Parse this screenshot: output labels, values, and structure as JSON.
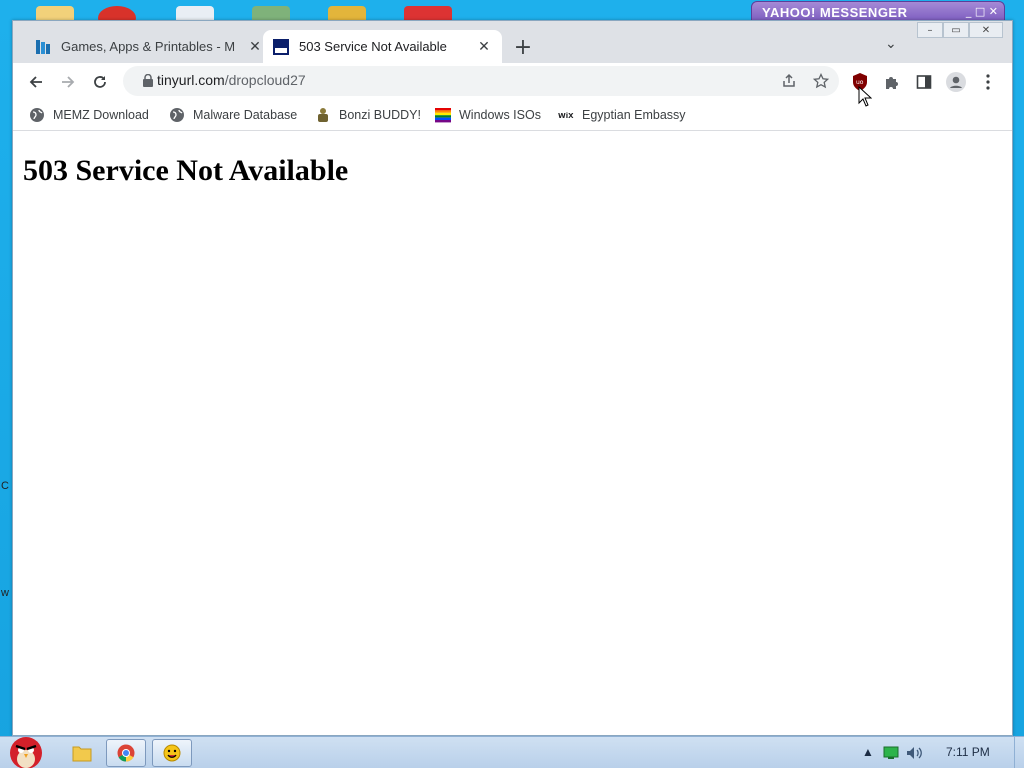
{
  "desktop": {
    "edge_letters": [
      "C",
      "w"
    ],
    "yahoo": {
      "title": "YAHOO! MESSENGER",
      "controls": "_ □ ✕"
    }
  },
  "tabs": [
    {
      "title": "Games, Apps & Printables - M",
      "favicon": "games-favicon",
      "active": false
    },
    {
      "title": "503 Service Not Available",
      "favicon": "tinyurl-favicon",
      "active": true
    }
  ],
  "toolbar": {
    "url_host": "tinyurl.com",
    "url_path": "/dropcloud27"
  },
  "bookmarks": [
    {
      "label": "MEMZ Download",
      "icon": "globe-icon"
    },
    {
      "label": "Malware Database",
      "icon": "globe-icon"
    },
    {
      "label": "Bonzi BUDDY!",
      "icon": "bonzi-icon"
    },
    {
      "label": "Windows ISOs",
      "icon": "rainbow-flag-icon"
    },
    {
      "label": "Egyptian Embassy",
      "icon": "wix-icon"
    }
  ],
  "page": {
    "heading": "503 Service Not Available"
  },
  "taskbar": {
    "clock": "7:11 PM"
  },
  "colors": {
    "tabstrip": "#dee1e6",
    "desktop": "#1ba9e6",
    "ublock": "#800000"
  }
}
